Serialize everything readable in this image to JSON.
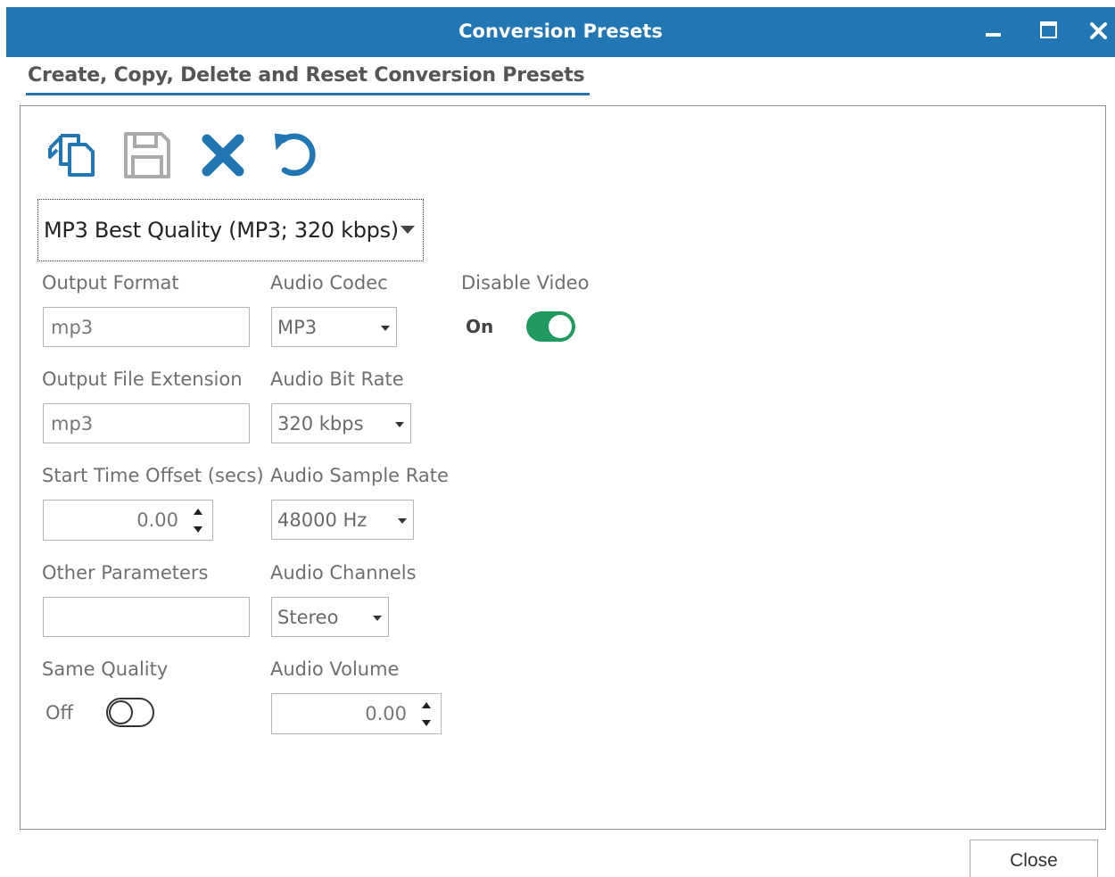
{
  "window": {
    "title": "Conversion Presets",
    "controls": {
      "minimize": "minimize-icon",
      "maximize": "maximize-icon",
      "close": "close-icon"
    }
  },
  "heading": "Create, Copy, Delete and Reset Conversion Presets",
  "toolbar": {
    "copy_icon": "copy-icon",
    "save_icon": "save-icon",
    "delete_icon": "delete-icon",
    "reset_icon": "reset-icon",
    "accent_color": "#2177b4"
  },
  "preset": {
    "selected": "MP3 Best Quality (MP3; 320 kbps)"
  },
  "fields": {
    "output_format": {
      "label": "Output Format",
      "value": "mp3"
    },
    "output_file_extension": {
      "label": "Output File Extension",
      "value": "mp3"
    },
    "start_time_offset": {
      "label": "Start Time Offset (secs)",
      "value": "0.00"
    },
    "other_parameters": {
      "label": "Other Parameters",
      "value": ""
    },
    "same_quality": {
      "label": "Same Quality",
      "state": "Off"
    },
    "audio_codec": {
      "label": "Audio Codec",
      "value": "MP3"
    },
    "audio_bit_rate": {
      "label": "Audio Bit Rate",
      "value": "320 kbps"
    },
    "audio_sample_rate": {
      "label": "Audio Sample Rate",
      "value": "48000 Hz"
    },
    "audio_channels": {
      "label": "Audio Channels",
      "value": "Stereo"
    },
    "audio_volume": {
      "label": "Audio Volume",
      "value": "0.00"
    },
    "disable_video": {
      "label": "Disable Video",
      "state": "On",
      "color": "#1f9b5f"
    }
  },
  "footer": {
    "close_label": "Close"
  }
}
